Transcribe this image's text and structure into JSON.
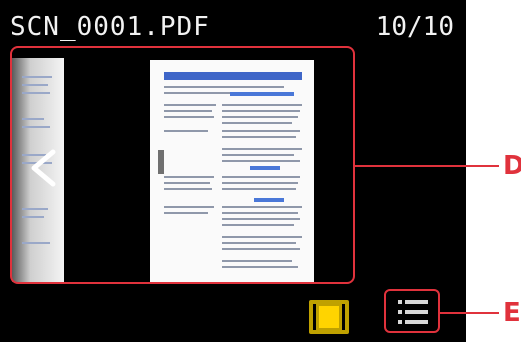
{
  "header": {
    "filename": "SCN_0001.PDF",
    "page_counter": "10/10"
  },
  "preview": {
    "prev_icon": "chevron-left-icon",
    "selected_border_color": "#e0323c"
  },
  "bottom_bar": {
    "single_view_icon": "single-page-view-icon",
    "single_view_color": "#ffd400",
    "list_view_icon": "list-view-icon"
  },
  "callouts": {
    "d": "D",
    "e": "E",
    "color": "#e0323c"
  }
}
